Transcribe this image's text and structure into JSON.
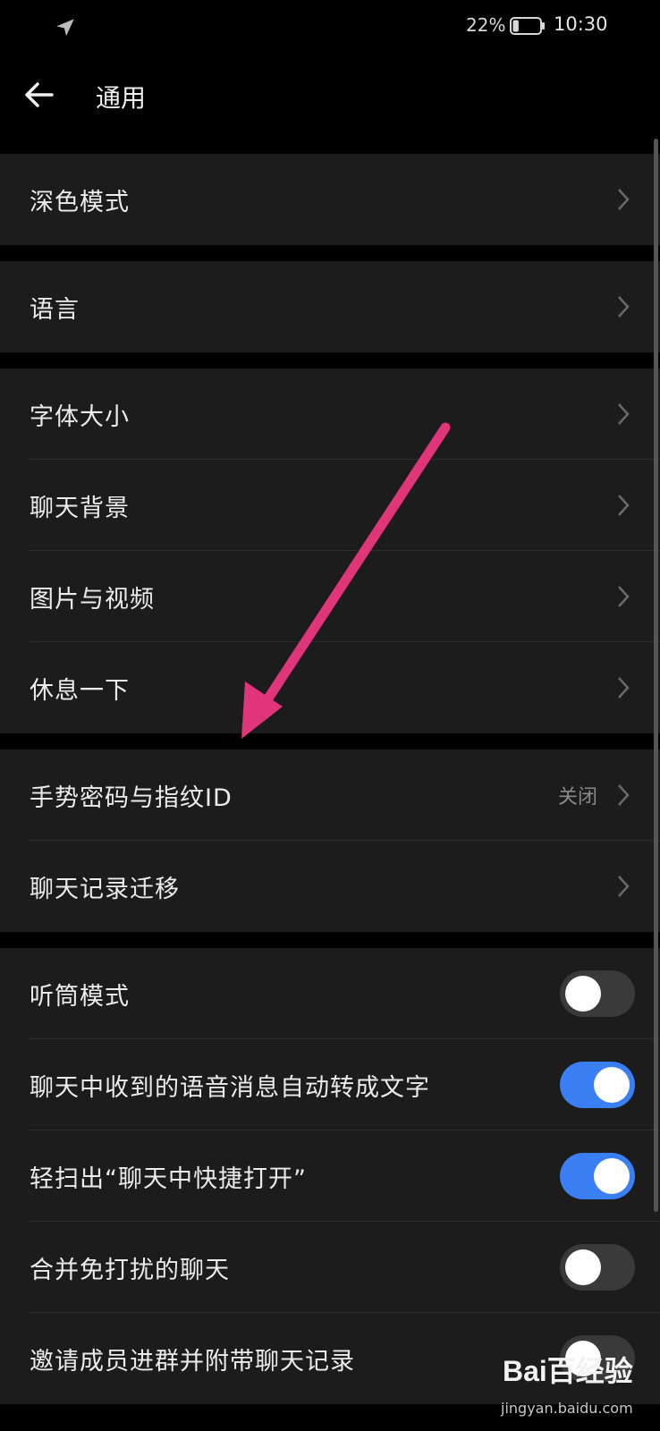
{
  "status_bar": {
    "battery_percent": "22%",
    "time": "10:30",
    "battery_level": 0.22
  },
  "header": {
    "title": "通用"
  },
  "groups": [
    {
      "rows": [
        {
          "label": "深色模式"
        }
      ]
    },
    {
      "rows": [
        {
          "label": "语言"
        }
      ]
    },
    {
      "rows": [
        {
          "label": "字体大小"
        },
        {
          "label": "聊天背景"
        },
        {
          "label": "图片与视频"
        },
        {
          "label": "休息一下"
        }
      ]
    },
    {
      "rows": [
        {
          "label": "手势密码与指纹ID",
          "value": "关闭"
        },
        {
          "label": "聊天记录迁移"
        }
      ]
    },
    {
      "rows": [
        {
          "label": "听筒模式",
          "toggle": false
        },
        {
          "label": "聊天中收到的语音消息自动转成文字",
          "toggle": true
        },
        {
          "label": "轻扫出“聊天中快捷打开”",
          "toggle": true
        },
        {
          "label": "合并免打扰的聊天",
          "toggle": false
        },
        {
          "label": "邀请成员进群并附带聊天记录",
          "toggle": false
        }
      ]
    }
  ],
  "colors": {
    "accent": "#3a7ff4",
    "annotation_arrow": "#e0357a",
    "background": "#000000",
    "cell": "#1c1c1c"
  },
  "watermark": {
    "logo": "Bai百经验",
    "url": "jingyan.baidu.com"
  }
}
